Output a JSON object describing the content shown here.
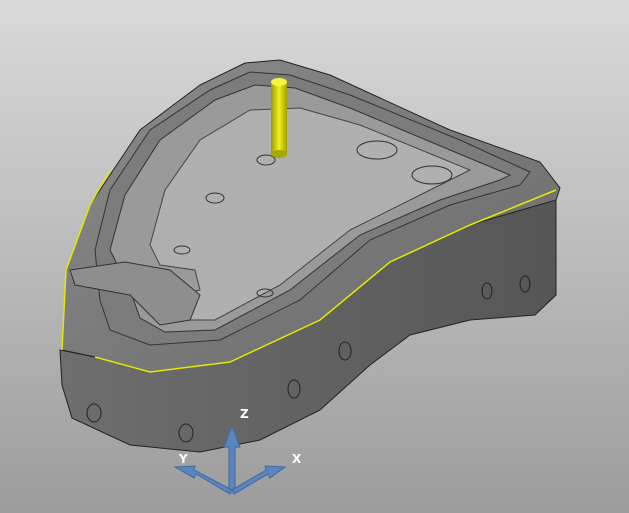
{
  "viewport": {
    "axes": {
      "x": "X",
      "y": "Y",
      "z": "Z"
    },
    "colors": {
      "part": "#6a6a6a",
      "edge_highlight": "#e8e800",
      "tool": "#d8d800",
      "triad": "#5b86bd"
    }
  }
}
